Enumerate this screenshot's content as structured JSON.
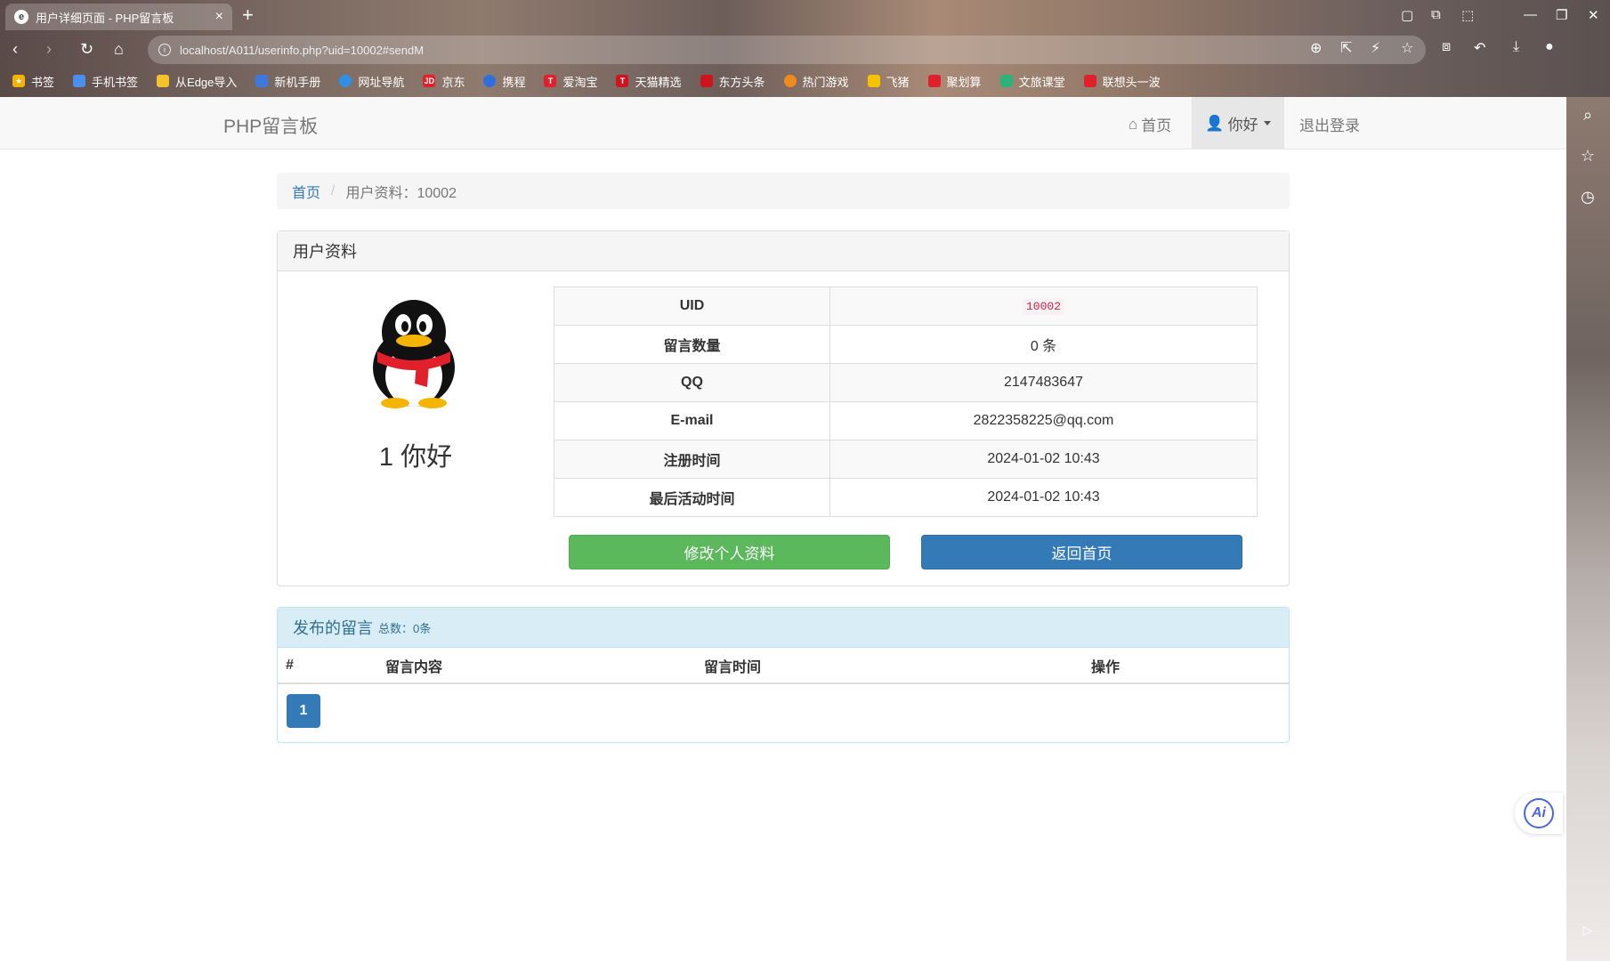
{
  "browser": {
    "tab_title": "用户详细页面 - PHP留言板",
    "url": "localhost/A011/userinfo.php?uid=10002#sendM",
    "bookmarks": [
      {
        "label": "书签",
        "color": "#f5b400"
      },
      {
        "label": "手机书签",
        "color": "#4a8ef0"
      },
      {
        "label": "从Edge导入",
        "color": "#f5c22e"
      },
      {
        "label": "新机手册",
        "color": "#3d78e0"
      },
      {
        "label": "网址导航",
        "color": "#2f8fe8"
      },
      {
        "label": "京东",
        "color": "#e0202a"
      },
      {
        "label": "携程",
        "color": "#2e6fe0"
      },
      {
        "label": "爱淘宝",
        "color": "#e0202a"
      },
      {
        "label": "天猫精选",
        "color": "#d0111e"
      },
      {
        "label": "东方头条",
        "color": "#d0111e"
      },
      {
        "label": "热门游戏",
        "color": "#f08a1c"
      },
      {
        "label": "飞猪",
        "color": "#f5c300"
      },
      {
        "label": "聚划算",
        "color": "#e0202a"
      },
      {
        "label": "文旅课堂",
        "color": "#2db37a"
      },
      {
        "label": "联想头一波",
        "color": "#e0202a"
      }
    ]
  },
  "navbar": {
    "brand": "PHP留言板",
    "home": "首页",
    "user": "你好",
    "logout": "退出登录"
  },
  "breadcrumb": {
    "home": "首页",
    "sep": "/",
    "current": "用户资料：10002"
  },
  "profile": {
    "heading": "用户资料",
    "display_name": "1 你好",
    "rows": [
      {
        "key": "UID",
        "value": "10002"
      },
      {
        "key": "留言数量",
        "value": "0 条"
      },
      {
        "key": "QQ",
        "value": "2147483647"
      },
      {
        "key": "E-mail",
        "value": "2822358225@qq.com"
      },
      {
        "key": "注册时间",
        "value": "2024-01-02 10:43"
      },
      {
        "key": "最后活动时间",
        "value": "2024-01-02 10:43"
      }
    ],
    "edit_button": "修改个人资料",
    "back_button": "返回首页"
  },
  "messages": {
    "heading": "发布的留言",
    "total": "总数：0条",
    "columns": [
      "#",
      "留言内容",
      "留言时间",
      "操作"
    ],
    "page": "1"
  },
  "colors": {
    "success": "#5cb85c",
    "primary": "#337ab7",
    "info_bg": "#d9edf7"
  }
}
